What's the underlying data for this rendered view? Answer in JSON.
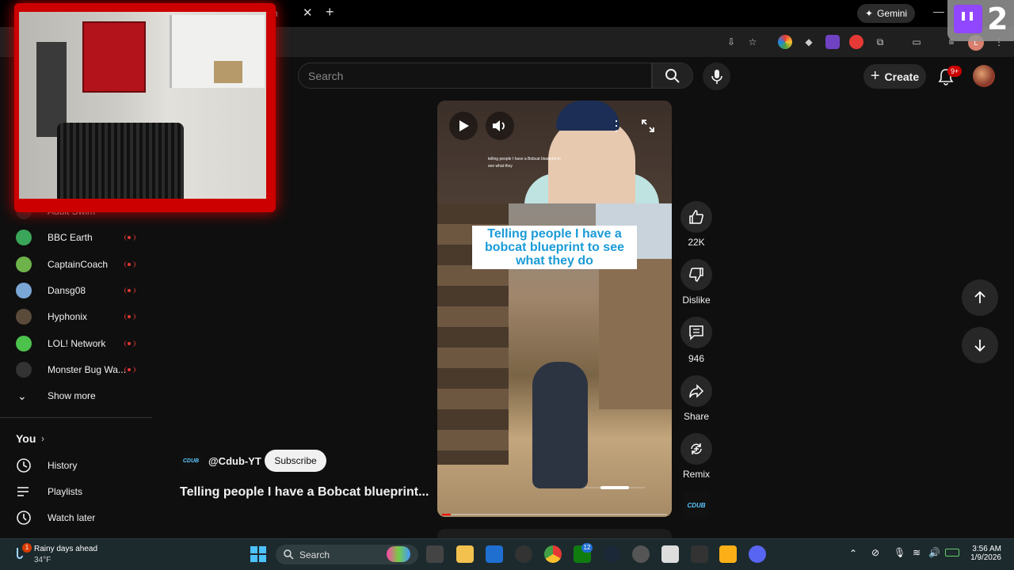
{
  "browser": {
    "tab_title_fragment": "ch",
    "gemini_label": "Gemini",
    "profile_initial": "L"
  },
  "twitch_overlay": {
    "count": "2",
    "brand_color": "#9146ff"
  },
  "youtube": {
    "search": {
      "placeholder": "Search"
    },
    "create_label": "Create",
    "notifications_badge": "9+"
  },
  "sidebar": {
    "subscriptions": [
      {
        "label": "Adult Swim",
        "icon": "adult-swim-icon",
        "color": "#222",
        "live": false,
        "dim": true
      },
      {
        "label": "BBC Earth",
        "icon": "bbc-earth-icon",
        "color": "#3aa65a",
        "live": true
      },
      {
        "label": "CaptainCoach",
        "icon": "captaincoach-icon",
        "color": "#6db24a",
        "live": true
      },
      {
        "label": "Dansg08",
        "icon": "dansg08-icon",
        "color": "#7aa6d6",
        "live": true
      },
      {
        "label": "Hyphonix",
        "icon": "hyphonix-icon",
        "color": "#5a4a3a",
        "live": true
      },
      {
        "label": "LOL! Network",
        "icon": "lol-network-icon",
        "color": "#4cc24c",
        "live": true
      },
      {
        "label": "Monster Bug Wa...",
        "icon": "monster-bug-wars-icon",
        "color": "#333",
        "live": true
      }
    ],
    "show_more_label": "Show more",
    "you_label": "You",
    "you_items": [
      {
        "label": "History",
        "icon": "history-icon"
      },
      {
        "label": "Playlists",
        "icon": "playlists-icon"
      },
      {
        "label": "Watch later",
        "icon": "watch-later-icon"
      }
    ]
  },
  "short": {
    "webcam_caption": "telling people I have a Bobcat blueprint to see what they",
    "overlay_text": "Telling people I have a bobcat blueprint to see what they do",
    "watermark": "",
    "progress": 0.04,
    "channel_handle": "@Cdub-YT",
    "channel_logo": "CDUB",
    "subscribe_label": "Subscribe",
    "title": "Telling people I have a Bobcat blueprint...",
    "actions": {
      "like_count": "22K",
      "dislike_label": "Dislike",
      "comment_count": "946",
      "share_label": "Share",
      "remix_label": "Remix"
    }
  },
  "taskbar": {
    "weather_text": "Rainy days ahead",
    "weather_temp": "34°F",
    "weather_badge": "1",
    "search_label": "Search",
    "xbox_badge": "12",
    "time": "3:56 AM",
    "date": "1/9/2026"
  }
}
